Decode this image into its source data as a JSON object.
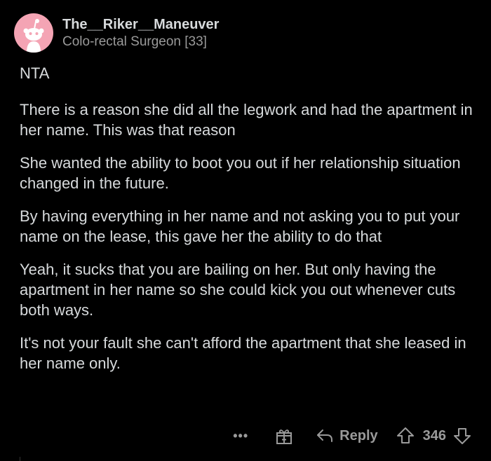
{
  "comment": {
    "author": "The__Riker__Maneuver",
    "flair": "Colo-rectal Surgeon [33]",
    "paragraphs": [
      "NTA",
      "There is a reason she did all the legwork and had the apartment in her name.  This was that reason",
      "She wanted the ability to boot you out if her relationship situation changed in the future.",
      "By having everything in her name and not asking you to put your name on the lease, this gave her the ability to do that",
      "Yeah, it sucks that you are bailing on her.   But only having the apartment in her name so she could kick you out whenever cuts both ways.",
      "It's not your fault she can't afford the apartment that she leased in her name only."
    ]
  },
  "actions": {
    "more": "•••",
    "reply_label": "Reply",
    "score": "346"
  },
  "icons": {
    "avatar": "snoo-avatar",
    "gift": "gift-icon",
    "reply": "reply-arrow-icon",
    "upvote": "upvote-arrow-icon",
    "downvote": "downvote-arrow-icon"
  },
  "colors": {
    "background": "#000000",
    "text": "#d7dadc",
    "muted": "#9a9a9a",
    "avatar_bg": "#f4a4b4"
  }
}
